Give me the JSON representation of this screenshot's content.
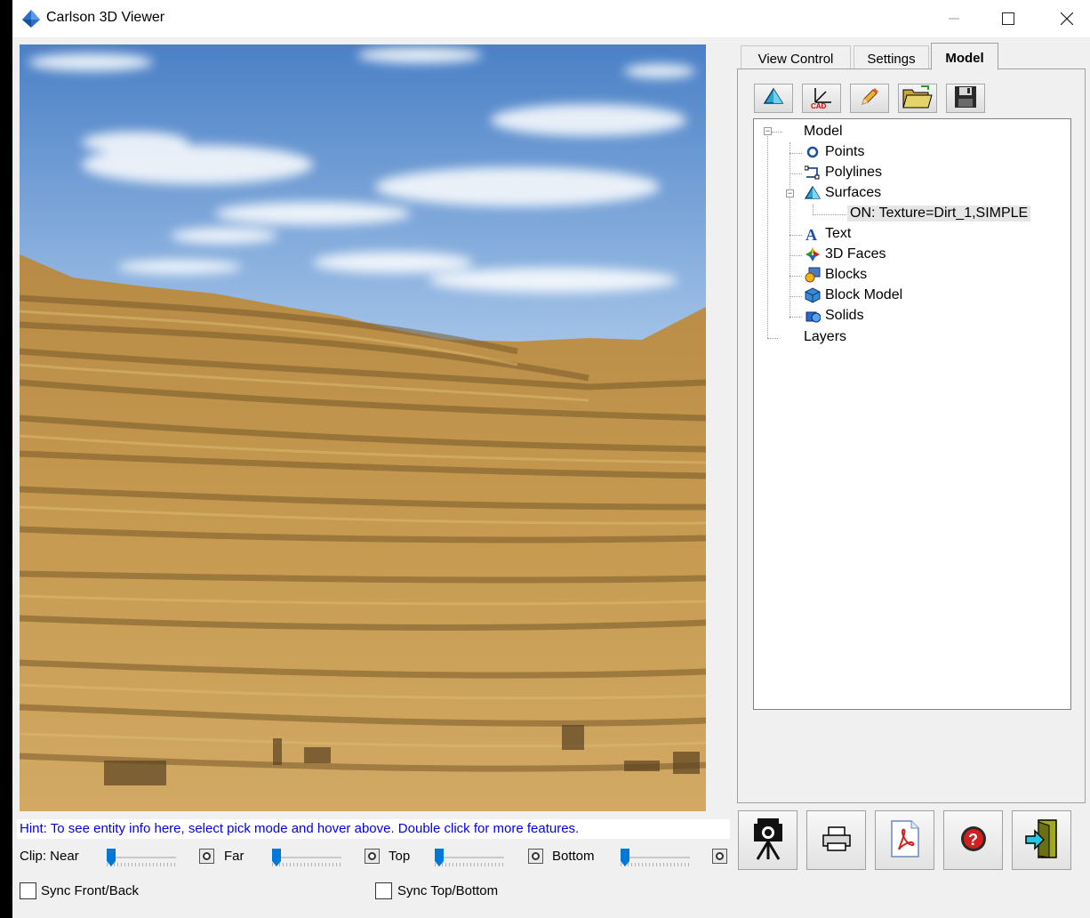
{
  "window": {
    "title": "Carlson 3D Viewer",
    "controls": {
      "minimize": "—",
      "maximize": "☐",
      "close": "✕"
    }
  },
  "viewport": {
    "scene": "terraced-pit-terrain",
    "colors": {
      "sky_top": "#4f86c9",
      "sky_bottom": "#a9c8ea",
      "dirt": "#c49a4a"
    }
  },
  "hint": "Hint: To see entity info here, select pick mode and hover above. Double click for more features.",
  "clip": {
    "label": "Clip: Near",
    "far_label": "Far",
    "top_label": "Top",
    "bottom_label": "Bottom",
    "sliders": [
      {
        "name": "near",
        "value": 0.0
      },
      {
        "name": "far",
        "value": 0.0
      },
      {
        "name": "top",
        "value": 0.0
      },
      {
        "name": "bottom",
        "value": 0.0
      }
    ]
  },
  "sync": {
    "front_back": {
      "label": "Sync Front/Back",
      "checked": false
    },
    "top_bottom": {
      "label": "Sync Top/Bottom",
      "checked": false
    }
  },
  "tabs": [
    {
      "label": "View Control",
      "active": false
    },
    {
      "label": "Settings",
      "active": false
    },
    {
      "label": "Model",
      "active": true
    }
  ],
  "toolbar": [
    {
      "icon": "surface-icon"
    },
    {
      "icon": "cad-axis-icon"
    },
    {
      "icon": "pencil-icon"
    },
    {
      "icon": "open-folder-icon"
    },
    {
      "icon": "save-disk-icon"
    }
  ],
  "tree": {
    "root": "Model",
    "items": {
      "points": "Points",
      "polylines": "Polylines",
      "surfaces": "Surfaces",
      "surface_child": "ON: Texture=Dirt_1,SIMPLE",
      "text": "Text",
      "faces": "3D Faces",
      "blocks": "Blocks",
      "block_model": "Block Model",
      "solids": "Solids"
    },
    "layers": "Layers"
  },
  "bottom_buttons": [
    {
      "icon": "camera-tripod-icon"
    },
    {
      "icon": "printer-icon"
    },
    {
      "icon": "pdf-icon"
    },
    {
      "icon": "help-icon"
    },
    {
      "icon": "exit-door-icon"
    }
  ]
}
